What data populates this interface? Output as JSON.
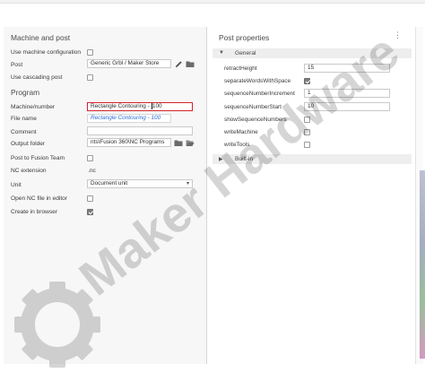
{
  "left_panel": {
    "machine_post": {
      "title": "Machine and post",
      "use_machine_config_label": "Use machine configuration",
      "use_machine_config_checked": false,
      "post_label": "Post",
      "post_value": "Generic Grbl / Maker Store",
      "use_cascading_label": "Use cascading post",
      "use_cascading_checked": false
    },
    "program": {
      "title": "Program",
      "number_label": "Machine/number",
      "number_value_before": "Rectangle Contouring - ",
      "number_value_after": "100",
      "file_name_label": "File name",
      "file_name_value": "Rectangle Contouring - 100",
      "comment_label": "Comment",
      "comment_value": "",
      "output_folder_label": "Output folder",
      "output_folder_value": "nts\\Fusion 360\\NC Programs",
      "post_to_team_label": "Post to Fusion Team",
      "post_to_team_checked": false,
      "nc_extension_label": "NC extension",
      "nc_extension_value": ".nc",
      "unit_label": "Unit",
      "unit_value": "Document unit",
      "open_nc_label": "Open NC file in editor",
      "open_nc_checked": false,
      "create_browser_label": "Create in browser",
      "create_browser_checked": true
    }
  },
  "right_panel": {
    "title": "Post properties",
    "general_group": "General",
    "builtin_group": "Built-in",
    "properties": [
      {
        "name": "retractHeight",
        "type": "number",
        "value": "15"
      },
      {
        "name": "separateWordsWithSpace",
        "type": "checkbox",
        "checked": true
      },
      {
        "name": "sequenceNumberIncrement",
        "type": "number",
        "value": "1"
      },
      {
        "name": "sequenceNumberStart",
        "type": "number",
        "value": "10"
      },
      {
        "name": "showSequenceNumbers",
        "type": "checkbox",
        "checked": false
      },
      {
        "name": "writeMachine",
        "type": "checkbox",
        "checked": false
      },
      {
        "name": "writeTools",
        "type": "checkbox",
        "checked": false
      }
    ]
  },
  "watermark": {
    "text": "Maker Hardware",
    "icon": "gear-icon"
  },
  "icons": {
    "post_edit": "pencil-icon",
    "post_folder": "folder-icon",
    "output_folder": "folder-icon",
    "output_open": "open-folder-icon",
    "kebab": "kebab-menu-icon",
    "unit_dropdown": "chevron-down-icon"
  }
}
